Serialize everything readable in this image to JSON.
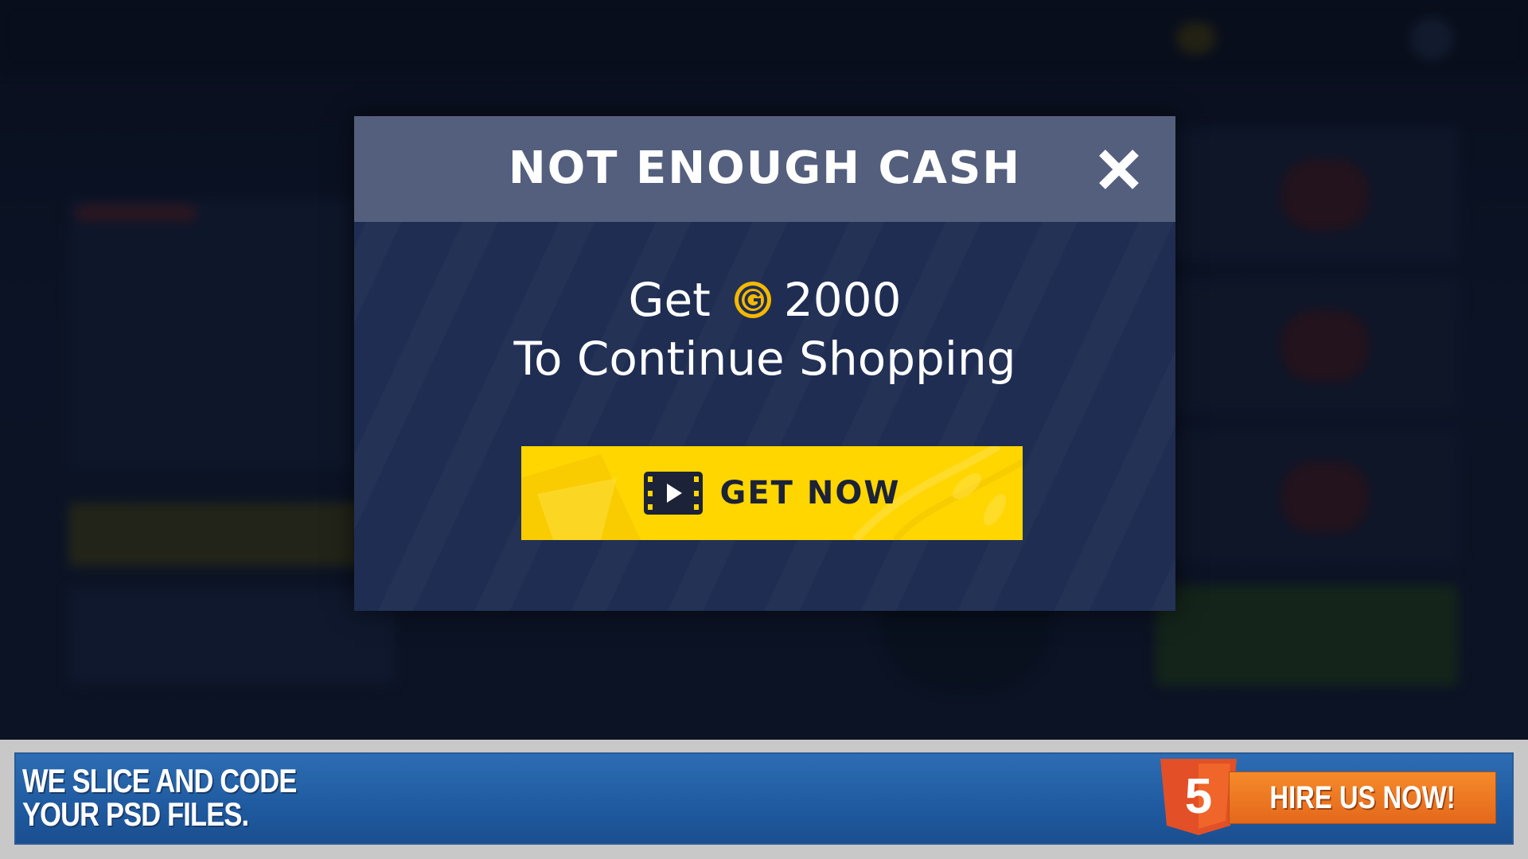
{
  "modal": {
    "title": "NOT ENOUGH CASH",
    "offer_prefix": "Get",
    "offer_amount": "2000",
    "offer_subtitle": "To Continue Shopping",
    "button_label": "GET NOW",
    "icons": {
      "close": "close-icon",
      "coin": "coin-icon",
      "button": "video-film-icon"
    }
  },
  "ad_banner": {
    "line1": "WE SLICE AND CODE",
    "line2": "YOUR PSD FILES.",
    "cta_label": "HIRE US NOW!",
    "badge_text": "5",
    "icons": {
      "badge": "html5-logo-icon"
    }
  },
  "colors": {
    "modal_header": "#545f7e",
    "modal_body": "#1f2d52",
    "button_yellow": "#ffd600",
    "coin_gold": "#f3b800",
    "ad_blue": "#1f5aa0",
    "ad_orange": "#e86f1f"
  }
}
